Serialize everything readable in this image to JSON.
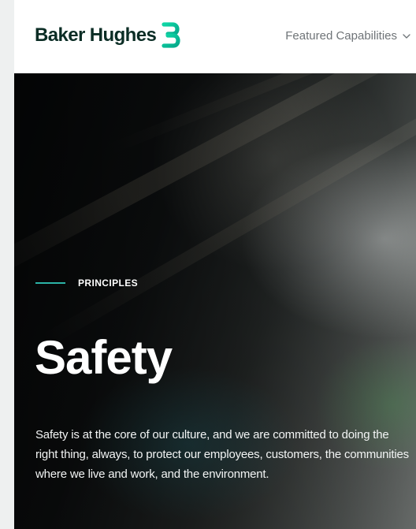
{
  "header": {
    "brand_name": "Baker Hughes",
    "nav": {
      "label": "Featured Capabilities"
    }
  },
  "icons": {
    "logo_mark": "baker-hughes-logo-icon",
    "nav_chevron": "chevron-down-icon"
  },
  "hero": {
    "eyebrow": "PRINCIPLES",
    "title": "Safety",
    "body": "Safety is at the core of our culture, and we are committed to doing the right thing, always, to protect our employees, customers, the communities where we live and work, and the environment."
  },
  "colors": {
    "brand_green": "#05c3a0",
    "accent_teal": "#2bb3a6",
    "brand_text": "#0b2d25",
    "nav_text": "#6f7478"
  }
}
